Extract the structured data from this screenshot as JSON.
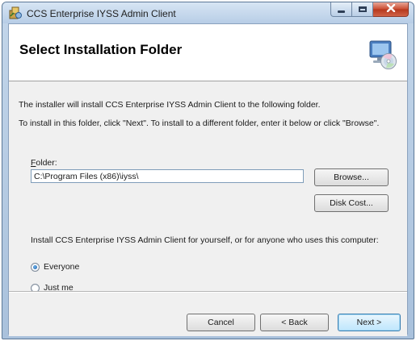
{
  "window": {
    "title": "CCS Enterprise IYSS Admin Client"
  },
  "header": {
    "title": "Select Installation Folder"
  },
  "body": {
    "intro_line1": "The installer will install CCS Enterprise IYSS Admin Client to the following folder.",
    "intro_line2": "To install in this folder, click \"Next\". To install to a different folder, enter it below or click \"Browse\".",
    "folder_label_accel": "F",
    "folder_label_rest": "older:",
    "folder_value": "C:\\Program Files (x86)\\iyss\\",
    "browse_label": "Browse...",
    "disk_cost_label": "Disk Cost...",
    "install_for_text": "Install CCS Enterprise IYSS Admin Client for yourself, or for anyone who uses this computer:",
    "radio_options": [
      {
        "label": "Everyone",
        "checked": true
      },
      {
        "label": "Just me",
        "checked": false
      }
    ]
  },
  "footer": {
    "cancel_label": "Cancel",
    "back_label": "< Back",
    "next_label": "Next >"
  },
  "icons": {
    "app": "installer-app-icon",
    "header": "computer-disc-icon",
    "minimize": "minimize-icon",
    "maximize": "maximize-icon",
    "close": "close-icon"
  },
  "colors": {
    "title_bar": "#b7cde6",
    "close_button": "#c94b30",
    "dialog_background": "#f0f0f0",
    "next_button_border": "#3c7fb1"
  }
}
